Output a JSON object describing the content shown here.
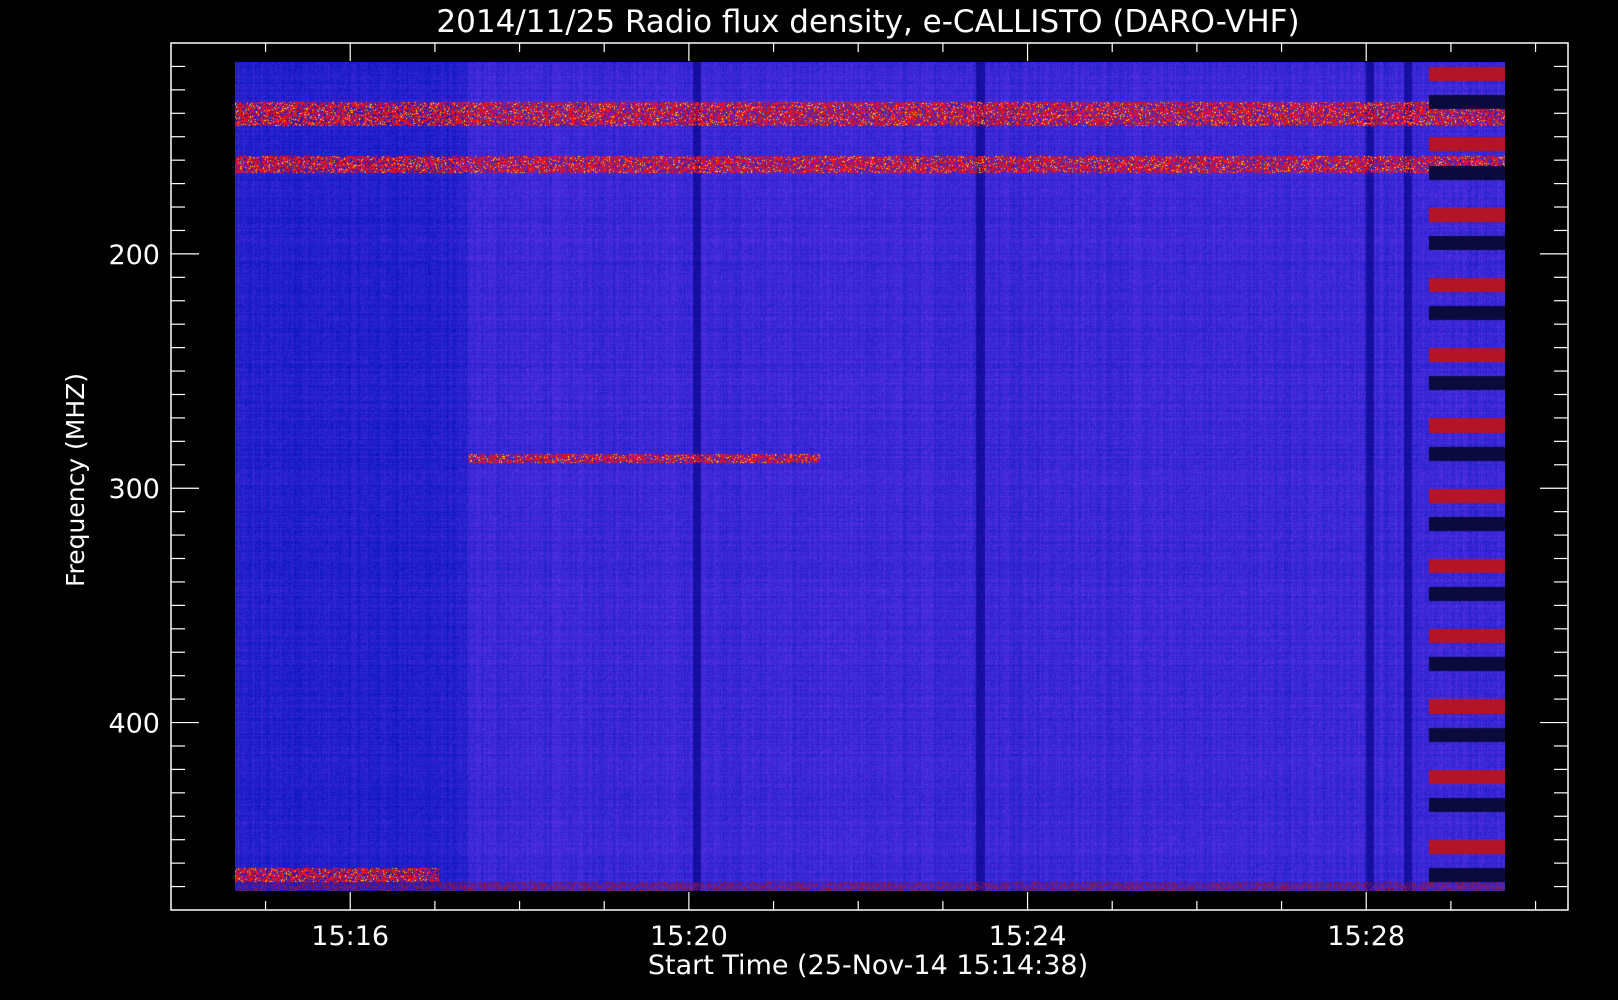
{
  "chart_data": {
    "type": "heatmap",
    "title": "2014/11/25  Radio flux density, e-CALLISTO (DARO-VHF)",
    "xlabel": "Start Time (25-Nov-14 15:14:38)",
    "ylabel": "Frequency (MHZ)",
    "x_start_time": "15:14:38",
    "x_tick_labels": [
      "15:16",
      "15:20",
      "15:24",
      "15:28"
    ],
    "x_tick_values_min": [
      1.3667,
      5.3667,
      9.3667,
      13.3667
    ],
    "x_range_min": [
      -0.75,
      15.75
    ],
    "data_range_min": [
      0.0,
      15.0
    ],
    "y_tick_labels": [
      "200",
      "300",
      "400"
    ],
    "y_tick_values": [
      200,
      300,
      400
    ],
    "ylim": [
      110,
      480
    ],
    "data_freq_range": [
      118,
      472
    ],
    "y_inverted": true,
    "colormap": [
      "#000000",
      "#1e1ed2",
      "#5a28c8",
      "#b41e3c",
      "#ff1e00",
      "#ffd700",
      "#ffffff"
    ],
    "background_level": "blue",
    "features": [
      {
        "type": "band",
        "freq": [
          135,
          145
        ],
        "note": "dense interference with bright spots"
      },
      {
        "type": "band",
        "freq": [
          158,
          165
        ],
        "note": "periodic bright striped band"
      },
      {
        "type": "band",
        "freq": [
          285,
          289
        ],
        "time_min": [
          2.75,
          6.9
        ],
        "note": "red segment"
      },
      {
        "type": "band",
        "freq": [
          462,
          468
        ],
        "time_min": [
          0.0,
          2.4
        ],
        "note": "red segment"
      },
      {
        "type": "region",
        "time_min": [
          0.0,
          2.75
        ],
        "note": "darker early segment"
      },
      {
        "type": "region",
        "time_min": [
          14.1,
          15.0
        ],
        "note": "striped red/dark end segment"
      }
    ]
  },
  "colors": {
    "background": "#000000",
    "axes": "#ffffff",
    "base": "#3c30d8"
  }
}
